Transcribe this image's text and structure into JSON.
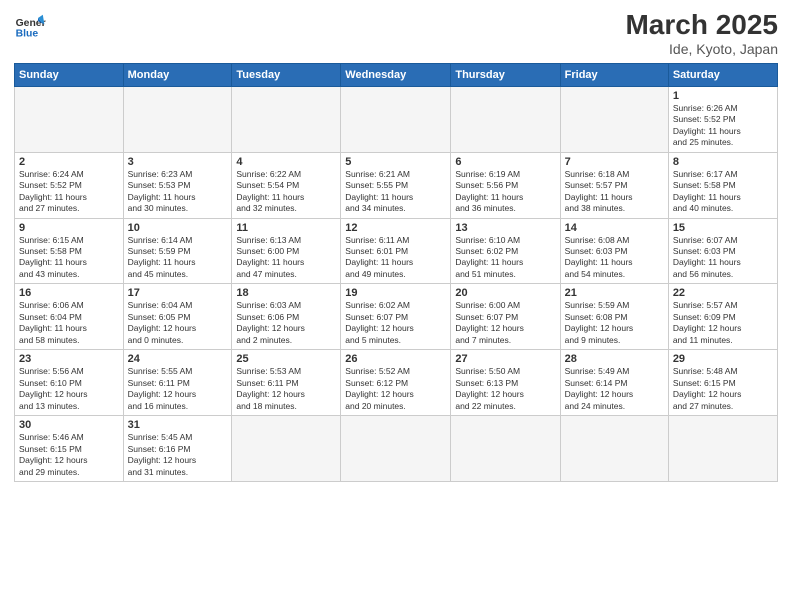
{
  "header": {
    "logo_general": "General",
    "logo_blue": "Blue",
    "title": "March 2025",
    "subtitle": "Ide, Kyoto, Japan"
  },
  "weekdays": [
    "Sunday",
    "Monday",
    "Tuesday",
    "Wednesday",
    "Thursday",
    "Friday",
    "Saturday"
  ],
  "weeks": [
    [
      {
        "day": "",
        "info": ""
      },
      {
        "day": "",
        "info": ""
      },
      {
        "day": "",
        "info": ""
      },
      {
        "day": "",
        "info": ""
      },
      {
        "day": "",
        "info": ""
      },
      {
        "day": "",
        "info": ""
      },
      {
        "day": "1",
        "info": "Sunrise: 6:26 AM\nSunset: 5:52 PM\nDaylight: 11 hours\nand 25 minutes."
      }
    ],
    [
      {
        "day": "2",
        "info": "Sunrise: 6:24 AM\nSunset: 5:52 PM\nDaylight: 11 hours\nand 27 minutes."
      },
      {
        "day": "3",
        "info": "Sunrise: 6:23 AM\nSunset: 5:53 PM\nDaylight: 11 hours\nand 30 minutes."
      },
      {
        "day": "4",
        "info": "Sunrise: 6:22 AM\nSunset: 5:54 PM\nDaylight: 11 hours\nand 32 minutes."
      },
      {
        "day": "5",
        "info": "Sunrise: 6:21 AM\nSunset: 5:55 PM\nDaylight: 11 hours\nand 34 minutes."
      },
      {
        "day": "6",
        "info": "Sunrise: 6:19 AM\nSunset: 5:56 PM\nDaylight: 11 hours\nand 36 minutes."
      },
      {
        "day": "7",
        "info": "Sunrise: 6:18 AM\nSunset: 5:57 PM\nDaylight: 11 hours\nand 38 minutes."
      },
      {
        "day": "8",
        "info": "Sunrise: 6:17 AM\nSunset: 5:58 PM\nDaylight: 11 hours\nand 40 minutes."
      }
    ],
    [
      {
        "day": "9",
        "info": "Sunrise: 6:15 AM\nSunset: 5:58 PM\nDaylight: 11 hours\nand 43 minutes."
      },
      {
        "day": "10",
        "info": "Sunrise: 6:14 AM\nSunset: 5:59 PM\nDaylight: 11 hours\nand 45 minutes."
      },
      {
        "day": "11",
        "info": "Sunrise: 6:13 AM\nSunset: 6:00 PM\nDaylight: 11 hours\nand 47 minutes."
      },
      {
        "day": "12",
        "info": "Sunrise: 6:11 AM\nSunset: 6:01 PM\nDaylight: 11 hours\nand 49 minutes."
      },
      {
        "day": "13",
        "info": "Sunrise: 6:10 AM\nSunset: 6:02 PM\nDaylight: 11 hours\nand 51 minutes."
      },
      {
        "day": "14",
        "info": "Sunrise: 6:08 AM\nSunset: 6:03 PM\nDaylight: 11 hours\nand 54 minutes."
      },
      {
        "day": "15",
        "info": "Sunrise: 6:07 AM\nSunset: 6:03 PM\nDaylight: 11 hours\nand 56 minutes."
      }
    ],
    [
      {
        "day": "16",
        "info": "Sunrise: 6:06 AM\nSunset: 6:04 PM\nDaylight: 11 hours\nand 58 minutes."
      },
      {
        "day": "17",
        "info": "Sunrise: 6:04 AM\nSunset: 6:05 PM\nDaylight: 12 hours\nand 0 minutes."
      },
      {
        "day": "18",
        "info": "Sunrise: 6:03 AM\nSunset: 6:06 PM\nDaylight: 12 hours\nand 2 minutes."
      },
      {
        "day": "19",
        "info": "Sunrise: 6:02 AM\nSunset: 6:07 PM\nDaylight: 12 hours\nand 5 minutes."
      },
      {
        "day": "20",
        "info": "Sunrise: 6:00 AM\nSunset: 6:07 PM\nDaylight: 12 hours\nand 7 minutes."
      },
      {
        "day": "21",
        "info": "Sunrise: 5:59 AM\nSunset: 6:08 PM\nDaylight: 12 hours\nand 9 minutes."
      },
      {
        "day": "22",
        "info": "Sunrise: 5:57 AM\nSunset: 6:09 PM\nDaylight: 12 hours\nand 11 minutes."
      }
    ],
    [
      {
        "day": "23",
        "info": "Sunrise: 5:56 AM\nSunset: 6:10 PM\nDaylight: 12 hours\nand 13 minutes."
      },
      {
        "day": "24",
        "info": "Sunrise: 5:55 AM\nSunset: 6:11 PM\nDaylight: 12 hours\nand 16 minutes."
      },
      {
        "day": "25",
        "info": "Sunrise: 5:53 AM\nSunset: 6:11 PM\nDaylight: 12 hours\nand 18 minutes."
      },
      {
        "day": "26",
        "info": "Sunrise: 5:52 AM\nSunset: 6:12 PM\nDaylight: 12 hours\nand 20 minutes."
      },
      {
        "day": "27",
        "info": "Sunrise: 5:50 AM\nSunset: 6:13 PM\nDaylight: 12 hours\nand 22 minutes."
      },
      {
        "day": "28",
        "info": "Sunrise: 5:49 AM\nSunset: 6:14 PM\nDaylight: 12 hours\nand 24 minutes."
      },
      {
        "day": "29",
        "info": "Sunrise: 5:48 AM\nSunset: 6:15 PM\nDaylight: 12 hours\nand 27 minutes."
      }
    ],
    [
      {
        "day": "30",
        "info": "Sunrise: 5:46 AM\nSunset: 6:15 PM\nDaylight: 12 hours\nand 29 minutes."
      },
      {
        "day": "31",
        "info": "Sunrise: 5:45 AM\nSunset: 6:16 PM\nDaylight: 12 hours\nand 31 minutes."
      },
      {
        "day": "",
        "info": ""
      },
      {
        "day": "",
        "info": ""
      },
      {
        "day": "",
        "info": ""
      },
      {
        "day": "",
        "info": ""
      },
      {
        "day": "",
        "info": ""
      }
    ]
  ]
}
